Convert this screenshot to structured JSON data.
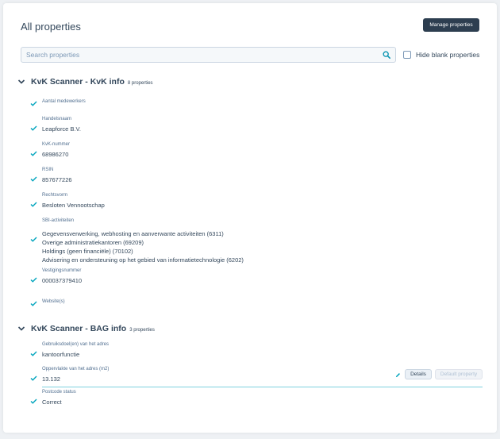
{
  "page": {
    "title": "All properties",
    "manage_label": "Manage properties",
    "search_placeholder": "Search properties",
    "hide_blank_label": "Hide blank properties"
  },
  "sections": [
    {
      "title": "KvK Scanner - KvK info",
      "count": "8 properties",
      "properties": [
        {
          "label": "Aantal medewerkers",
          "values": []
        },
        {
          "label": "Handelsnaam",
          "values": [
            "Leapforce B.V."
          ]
        },
        {
          "label": "KvK-nummer",
          "values": [
            "68986270"
          ]
        },
        {
          "label": "RSIN",
          "values": [
            "857677226"
          ]
        },
        {
          "label": "Rechtsvorm",
          "values": [
            "Besloten Vennootschap"
          ]
        },
        {
          "label": "SBI-activiteiten",
          "values": [
            "Gegevensverwerking, webhosting en aanverwante activiteiten (6311)",
            "Overige administratiekantoren (69209)",
            "Holdings (geen financiële) (70102)",
            "Advisering en ondersteuning op het gebied van informatietechnologie (6202)"
          ]
        },
        {
          "label": "Vestigingsnummer",
          "values": [
            "000037379410"
          ]
        },
        {
          "label": "Website(s)",
          "values": []
        }
      ]
    },
    {
      "title": "KvK Scanner - BAG info",
      "count": "3 properties",
      "properties": [
        {
          "label": "Gebruiksdoel(en) van het adres",
          "values": [
            "kantoorfunctie"
          ]
        },
        {
          "label": "Oppervlakte van het adres (m2)",
          "values": [
            "13.132"
          ]
        },
        {
          "label": "Postcode status",
          "values": [
            "Correct"
          ]
        }
      ]
    }
  ],
  "edit": {
    "details_label": "Details",
    "default_label": "Default property"
  },
  "colors": {
    "check": "#00a4bd",
    "dark_button": "#2d3e50",
    "focus_line": "#7fd1de"
  }
}
